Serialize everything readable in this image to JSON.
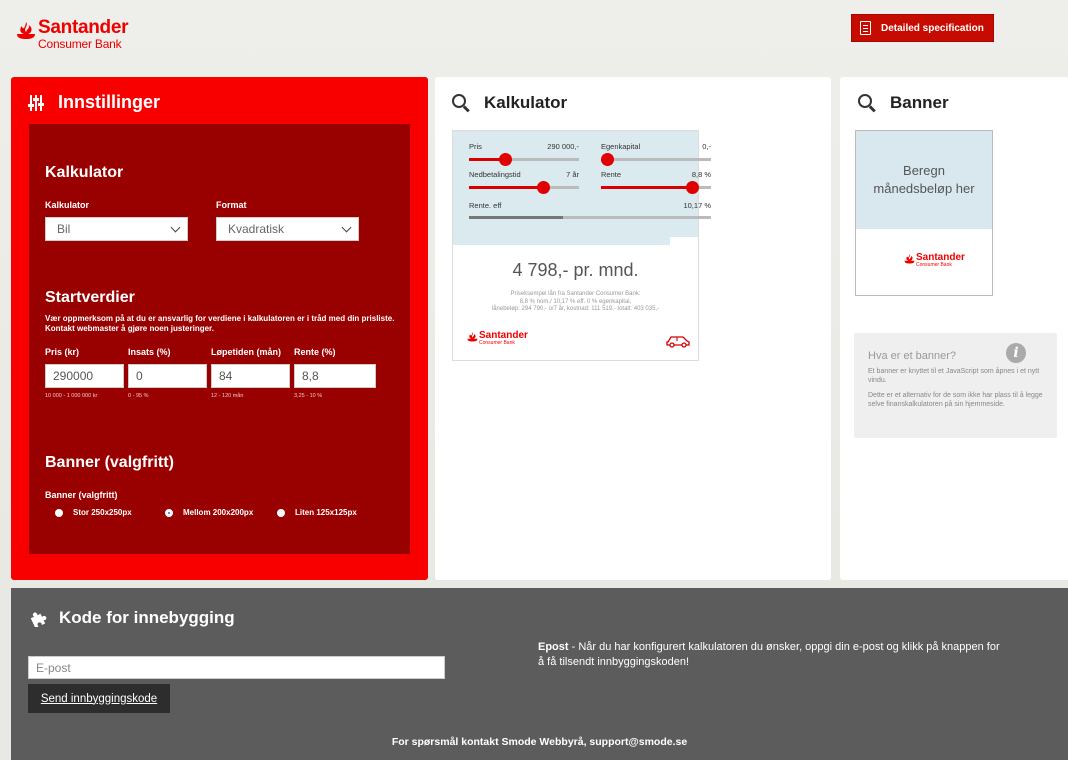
{
  "header": {
    "brand_name": "Santander",
    "brand_sub": "Consumer Bank",
    "spec_button": "Detailed specification"
  },
  "settings": {
    "title": "Innstillinger",
    "calc_section": "Kalkulator",
    "calc_label": "Kalkulator",
    "calc_value": "Bil",
    "format_label": "Format",
    "format_value": "Kvadratisk",
    "start_section": "Startverdier",
    "note": "Vær oppmerksom på at du er ansvarlig for verdiene i kalkulatoren er i tråd med din prisliste. Kontakt webmaster å gjøre noen justeringer.",
    "fields": [
      {
        "label": "Pris (kr)",
        "value": "290000",
        "hint": "10 000 - 1 000 000 kr"
      },
      {
        "label": "Insats (%)",
        "value": "0",
        "hint": "0 - 95 %"
      },
      {
        "label": "Løpetiden (mån)",
        "value": "84",
        "hint": "12 - 120 mån"
      },
      {
        "label": "Rente (%)",
        "value": "8,8",
        "hint": "3,25 - 10 %"
      }
    ],
    "banner_section": "Banner (valgfritt)",
    "banner_label": "Banner (valgfritt)",
    "banner_options": [
      "Stor 250x250px",
      "Mellom 200x200px",
      "Liten 125x125px"
    ],
    "banner_selected": "Mellom 200x200px"
  },
  "calculator": {
    "title": "Kalkulator",
    "sliders": [
      {
        "label": "Pris",
        "value": "290 000,-",
        "level": 0.33
      },
      {
        "label": "Egenkapital",
        "value": "0,-",
        "level": 0.0
      },
      {
        "label": "Nedbetalingstid",
        "value": "7 år",
        "level": 0.67
      },
      {
        "label": "Rente",
        "value": "8,8 %",
        "level": 0.83
      }
    ],
    "eff_label": "Rente. eff",
    "eff_value": "10,17 %",
    "eff_level": 0.39,
    "monthly": "4 798,- pr. mnd.",
    "example_line1": "Priseksempel lån fra Santander Consumer Bank:",
    "example_line2": "8,8 % nom./ 10,17 % eff. 0 % egenkapital,",
    "example_line3": "lånebeløp: 294 790,- o/7 år, kostnad: 111 519,- totalt: 403 035,-",
    "logo_name": "Santander",
    "logo_sub": "Consumer Bank"
  },
  "banner": {
    "title": "Banner",
    "box_line1": "Beregn",
    "box_line2": "månedsbeløp her",
    "logo_name": "Santander",
    "logo_sub": "Consumer Bank",
    "info_title": "Hva er et banner?",
    "info_p1": "Et banner er knyttet til et JavaScript som åpnes i et nytt vindu.",
    "info_p2": "Dette er et alternativ for de som ikke har plass til å legge selve finanskalkulatoren på sin hjemmeside."
  },
  "embed": {
    "title": "Kode for innebygging",
    "email_placeholder": "E-post",
    "send_button": "Send innbyggingskode",
    "epost_bold": "Epost",
    "epost_text": " - Når du har konfigurert kalkulatoren du ønsker, oppgi din e-post og klikk på knappen for å få tilsendt innbyggingskoden!",
    "footer": "For spørsmål kontakt Smode Webbyrå, support@smode.se"
  },
  "colors": {
    "brand_red": "#ec0000",
    "panel_red": "#f80000",
    "inner_red": "#990000",
    "dark_bar": "#5c5c5c"
  }
}
